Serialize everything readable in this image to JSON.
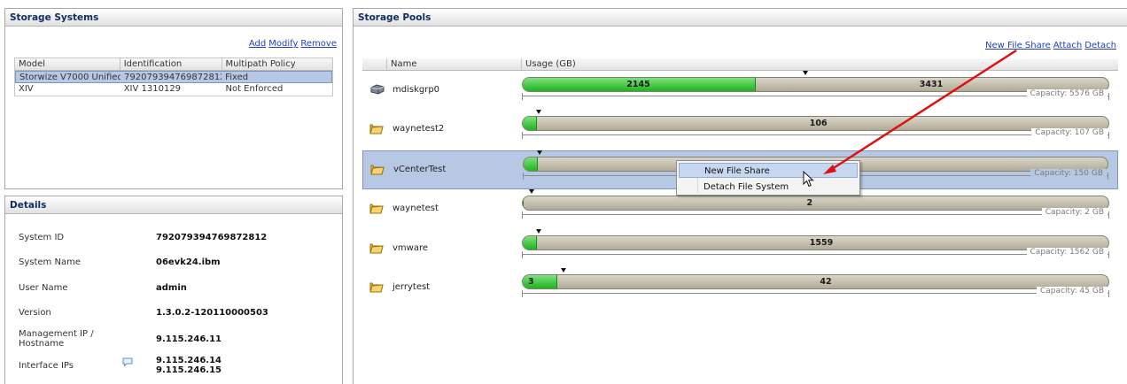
{
  "systems_panel": {
    "title": "Storage Systems",
    "actions": [
      "Add",
      "Modify",
      "Remove"
    ],
    "columns": [
      "Model",
      "Identification",
      "Multipath Policy"
    ],
    "rows": [
      {
        "model": "Storwize V7000 Unified",
        "identification": "792079394769872812...",
        "policy": "Fixed",
        "selected": true
      },
      {
        "model": "XIV",
        "identification": "XIV 1310129",
        "policy": "Not Enforced",
        "selected": false
      }
    ]
  },
  "details_panel": {
    "title": "Details",
    "fields": [
      {
        "label": "System ID",
        "value": "792079394769872812"
      },
      {
        "label": "System Name",
        "value": "06evk24.ibm"
      },
      {
        "label": "User Name",
        "value": "admin"
      },
      {
        "label": "Version",
        "value": "1.3.0.2-120110000503"
      },
      {
        "label": "Management IP / Hostname",
        "value": "9.115.246.11"
      },
      {
        "label": "Interface IPs",
        "value": "9.115.246.14",
        "value2": "9.115.246.15"
      }
    ],
    "interface_icon": "comment-bubble-icon"
  },
  "pools_panel": {
    "title": "Storage Pools",
    "actions": [
      "New File Share",
      "Attach",
      "Detach"
    ],
    "columns": [
      "Name",
      "Usage (GB)"
    ],
    "pools": [
      {
        "name": "mdiskgrp0",
        "icon": "disk-drive-icon",
        "used": 2145,
        "free": 3431,
        "used_fraction": 0.385,
        "capacity": "Capacity: 5576 GB",
        "selected": false
      },
      {
        "name": "waynetest2",
        "icon": "folder-icon",
        "used": null,
        "free": 106,
        "used_fraction": 0.01,
        "capacity": "Capacity: 107 GB",
        "selected": false
      },
      {
        "name": "vCenterTest",
        "icon": "folder-icon",
        "used": null,
        "free": null,
        "used_fraction": 0.01,
        "capacity": "Capacity: 150 GB",
        "selected": true
      },
      {
        "name": "waynetest",
        "icon": "folder-icon",
        "used": null,
        "free": 2,
        "used_fraction": 0.0,
        "capacity": "Capacity: 2 GB",
        "selected": false
      },
      {
        "name": "vmware",
        "icon": "folder-icon",
        "used": null,
        "free": 1559,
        "used_fraction": 0.01,
        "capacity": "Capacity: 1562 GB",
        "selected": false
      },
      {
        "name": "jerrytest",
        "icon": "folder-icon",
        "used": 3,
        "free": 42,
        "used_fraction": 0.045,
        "capacity": "Capacity: 45 GB",
        "selected": false
      }
    ]
  },
  "context_menu": {
    "items": [
      "New File Share",
      "Detach File System"
    ],
    "highlighted": "New File Share"
  },
  "colors": {
    "header_text": "#0e2f63",
    "selection": "#b6c8e3",
    "used_bar": "#1fb41f",
    "free_bar": "#b0ab98",
    "annotation_arrow": "#e01010",
    "link": "#1f3fbf"
  }
}
